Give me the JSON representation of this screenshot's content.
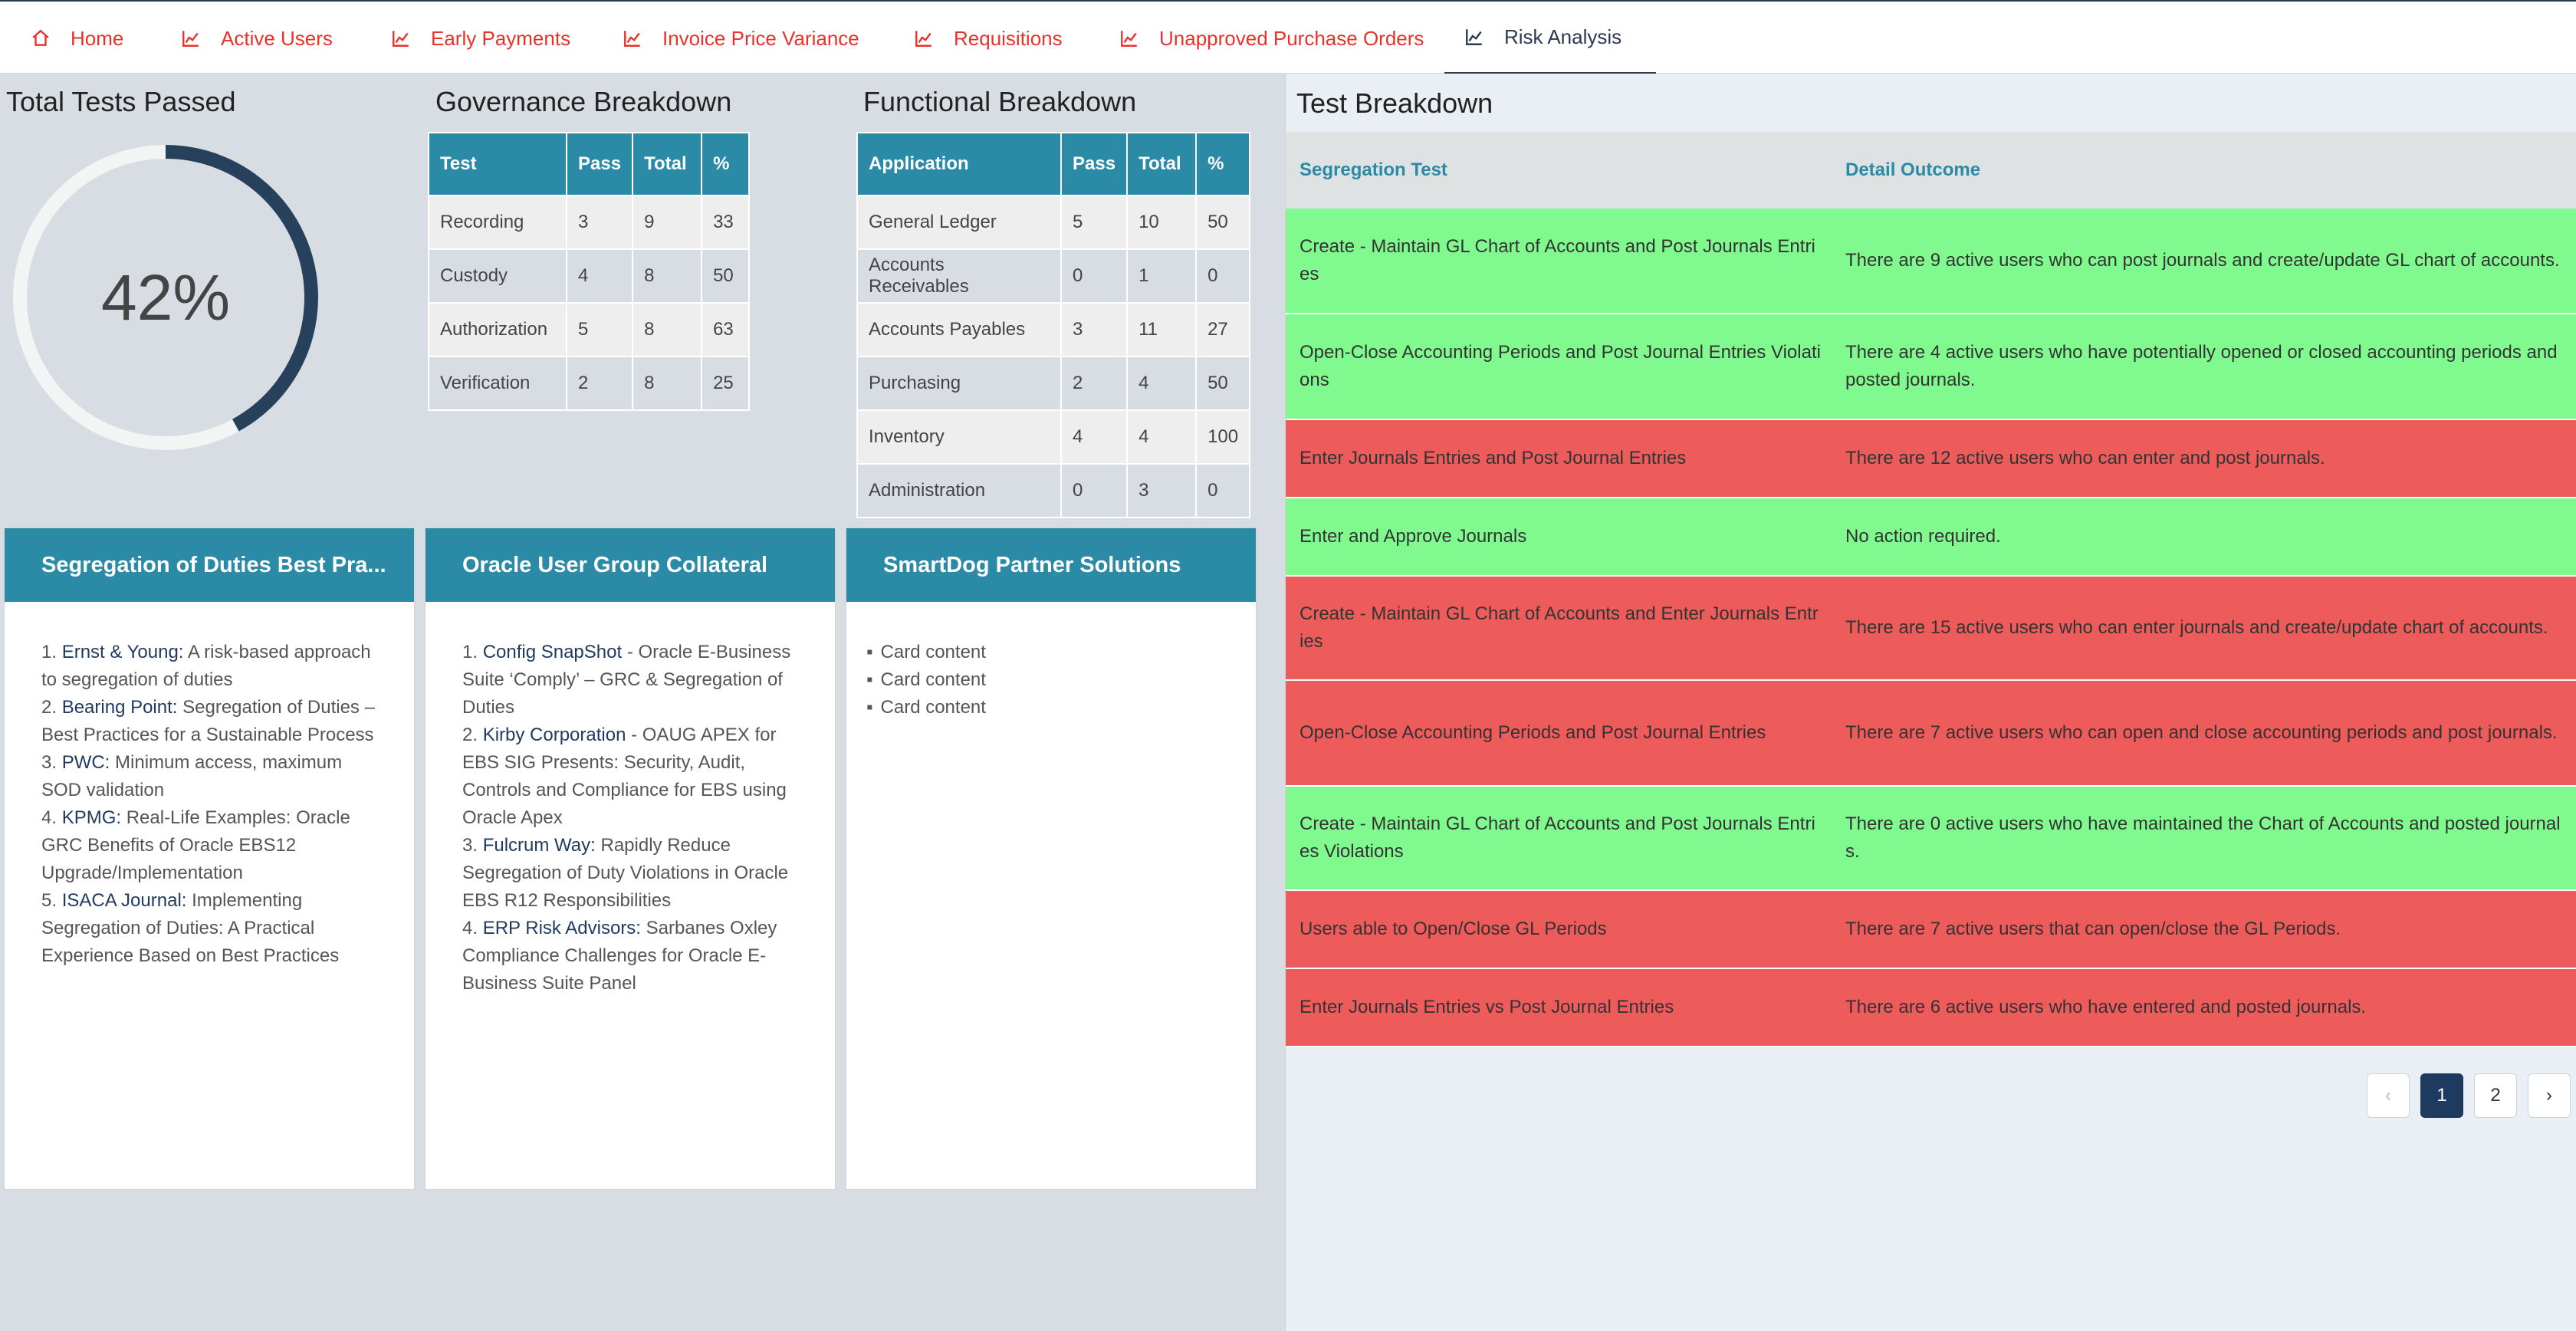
{
  "nav": {
    "tabs": [
      {
        "label": "Home",
        "icon": "home-icon"
      },
      {
        "label": "Active Users",
        "icon": "chart-icon"
      },
      {
        "label": "Early Payments",
        "icon": "chart-icon"
      },
      {
        "label": "Invoice Price Variance",
        "icon": "chart-icon"
      },
      {
        "label": "Requisitions",
        "icon": "chart-icon"
      },
      {
        "label": "Unapproved Purchase Orders",
        "icon": "chart-icon"
      },
      {
        "label": "Risk Analysis",
        "icon": "chart-icon"
      }
    ],
    "active": "Risk Analysis"
  },
  "total_tests": {
    "title": "Total Tests Passed",
    "percent_label": "42%",
    "percent": 42
  },
  "governance": {
    "title": "Governance Breakdown",
    "columns": [
      "Test",
      "Pass",
      "Total",
      "%"
    ],
    "rows": [
      [
        "Recording",
        "3",
        "9",
        "33"
      ],
      [
        "Custody",
        "4",
        "8",
        "50"
      ],
      [
        "Authorization",
        "5",
        "8",
        "63"
      ],
      [
        "Verification",
        "2",
        "8",
        "25"
      ]
    ]
  },
  "functional": {
    "title": "Functional Breakdown",
    "columns": [
      "Application",
      "Pass",
      "Total",
      "%"
    ],
    "rows": [
      [
        "General Ledger",
        "5",
        "10",
        "50"
      ],
      [
        "Accounts Receivables",
        "0",
        "1",
        "0"
      ],
      [
        "Accounts Payables",
        "3",
        "11",
        "27"
      ],
      [
        "Purchasing",
        "2",
        "4",
        "50"
      ],
      [
        "Inventory",
        "4",
        "4",
        "100"
      ],
      [
        "Administration",
        "0",
        "3",
        "0"
      ]
    ]
  },
  "cards": {
    "sod": {
      "title": "Segregation of Duties Best Pra...",
      "items": [
        {
          "num": "1.",
          "link": "Ernst & Young:",
          "text": " A risk-based approach to segregation of duties"
        },
        {
          "num": "2.",
          "link": "Bearing Point:",
          "text": " Segregation of Duties – Best Practices for a Sustainable Process"
        },
        {
          "num": "3.",
          "link": "PWC:",
          "text": " Minimum access, maximum SOD validation"
        },
        {
          "num": "4.",
          "link": "KPMG:",
          "text": " Real-Life Examples: Oracle GRC Benefits of Oracle EBS12 Upgrade/Implementation"
        },
        {
          "num": "5.",
          "link": "ISACA Journal:",
          "text": " Implementing Segregation of Duties: A Practical Experience Based on Best Practices"
        }
      ]
    },
    "oug": {
      "title": "Oracle User Group Collateral",
      "items": [
        {
          "num": "1.",
          "link": "Config SnapShot",
          "text": " - Oracle E-Business Suite ‘Comply’ – GRC & Segregation of Duties"
        },
        {
          "num": "2.",
          "link": "Kirby Corporation",
          "text": " - OAUG APEX for EBS SIG Presents: Security, Audit, Controls and Compliance for EBS using Oracle Apex"
        },
        {
          "num": "3.",
          "link": "Fulcrum Way:",
          "text": " Rapidly Reduce Segregation of Duty Violations in Oracle EBS R12 Responsibilities"
        },
        {
          "num": "4.",
          "link": "ERP Risk Advisors:",
          "text": " Sarbanes Oxley Compliance Challenges for Oracle E-Business Suite Panel"
        }
      ]
    },
    "smartdog": {
      "title": "SmartDog Partner Solutions",
      "items": [
        "Card content",
        "Card content",
        "Card content"
      ]
    }
  },
  "test_breakdown": {
    "title": "Test Breakdown",
    "columns": [
      "Segregation Test",
      "Detail Outcome"
    ],
    "colors": {
      "pass": "#80fa8e",
      "fail": "#ee5b5b"
    },
    "rows": [
      {
        "test": "Create - Maintain GL Chart of Accounts and Post Journals Entries",
        "outcome": " There are 9 active users who can post journals and create/update GL chart of accounts.",
        "status": "pass"
      },
      {
        "test": "Open-Close Accounting Periods and Post Journal Entries Violations",
        "outcome": " There are 4 active users who have potentially opened or closed accounting periods and posted journals.",
        "status": "pass"
      },
      {
        "test": "Enter Journals Entries and Post Journal Entries",
        "outcome": " There are 12 active users who can enter and post journals.",
        "status": "fail"
      },
      {
        "test": "Enter and Approve Journals",
        "outcome": "No action required.",
        "status": "pass"
      },
      {
        "test": "Create - Maintain GL Chart of Accounts and Enter Journals Entries",
        "outcome": " There are 15 active users who can enter journals and create/update chart of accounts.",
        "status": "fail"
      },
      {
        "test": "Open-Close Accounting Periods and Post Journal Entries",
        "outcome": " There are 7 active users who can open and close accounting periods and post journals.",
        "status": "fail"
      },
      {
        "test": "Create - Maintain GL Chart of Accounts and Post Journals Entries Violations",
        "outcome": " There are 0 active users who have maintained the Chart of Accounts and posted journals.",
        "status": "pass"
      },
      {
        "test": "Users able to Open/Close GL Periods",
        "outcome": "There are 7 active users that can open/close the GL Periods.",
        "status": "fail"
      },
      {
        "test": "Enter Journals Entries vs Post Journal Entries",
        "outcome": " There are 6 active users who have entered and posted journals.",
        "status": "fail"
      }
    ],
    "pagination": {
      "prev": "‹",
      "pages": [
        "1",
        "2"
      ],
      "current": "1",
      "next": "›"
    }
  }
}
